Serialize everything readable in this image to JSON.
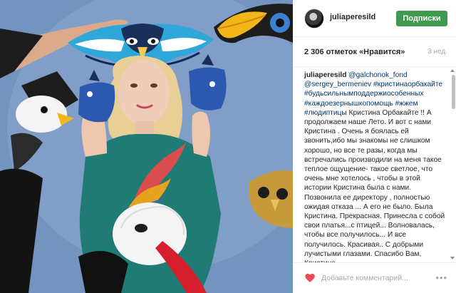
{
  "header": {
    "username": "juliaperesild",
    "follow_label": "Подписки"
  },
  "stats": {
    "likes": "2 306 отметок «Нравится»",
    "age": "3 нед."
  },
  "caption": {
    "author": "juliaperesild",
    "parts": [
      {
        "type": "tag",
        "text": "@galchonok_fond"
      },
      {
        "type": "text",
        "text": " "
      },
      {
        "type": "tag",
        "text": "@sergey_bermeniev"
      },
      {
        "type": "text",
        "text": " "
      },
      {
        "type": "tag",
        "text": "#кристинаорбакайте"
      },
      {
        "type": "text",
        "text": " "
      },
      {
        "type": "tag",
        "text": "#будьсильнымподдержиособенных"
      },
      {
        "type": "text",
        "text": " "
      },
      {
        "type": "tag",
        "text": "#каждоезернышкопомощь"
      },
      {
        "type": "text",
        "text": " "
      },
      {
        "type": "tag",
        "text": "#жжем"
      },
      {
        "type": "text",
        "text": " "
      },
      {
        "type": "tag",
        "text": "#людиптицы"
      },
      {
        "type": "text",
        "text": " Кристина Орбакайте !! А продолжаем наше Лето. И вот с нами Кристина . Очень я боялась ей звонить,ибо мы знакомы не слишком хорошо, но все те разы, когда мы встречались производили на меня такое теплое ощущение- такое светлое, что очень мне хотелось , чтобы в этой истории Кристина была с нами. Позвонила ее директору , полностью ожидая отказа ... А его не было. Была Кристина. Прекрасная. Принесла с собой свои платья...с птицей... Волновалась, чтобы все получилось... И все получилось. Красивая.. С добрыми лучистыми глазами. Спасибо Вам, Кристина,"
      }
    ]
  },
  "footer": {
    "comment_placeholder": "Добавьте комментарий...",
    "more_label": "•••"
  },
  "icons": {
    "like": "heart-icon",
    "more": "ellipsis-icon"
  },
  "colors": {
    "follow_button": "#3e9a4c",
    "hashtag": "#003569",
    "like_heart": "#ed4956",
    "muted_text": "#a5a7aa"
  }
}
